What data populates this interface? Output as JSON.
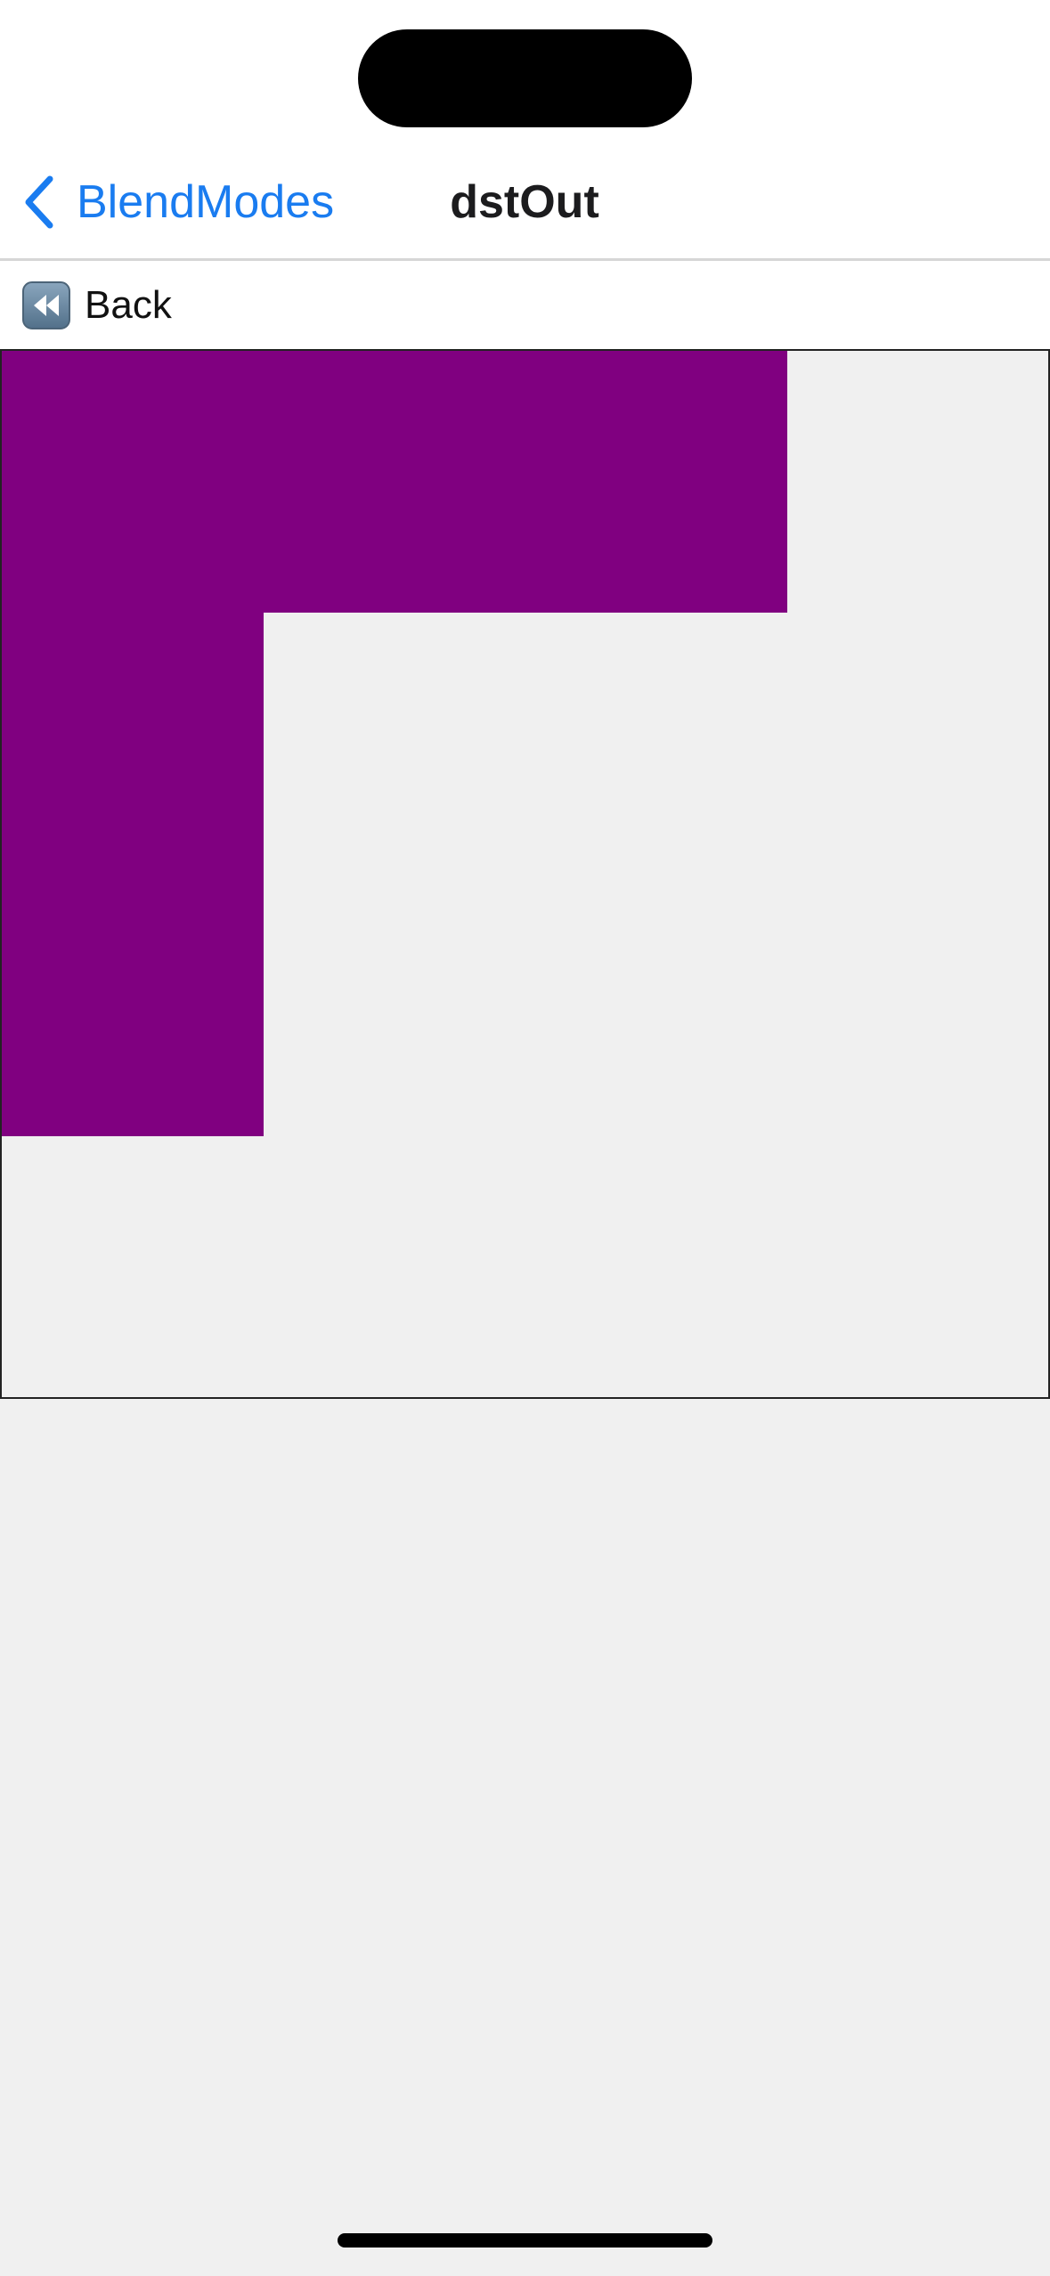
{
  "nav": {
    "back_label": "BlendModes",
    "title": "dstOut"
  },
  "toolbar": {
    "back_button_label": "Back",
    "back_icon": "rewind-icon"
  },
  "canvas": {
    "shape_color": "#800080",
    "background_color": "#f0f0f0",
    "blend_mode": "dstOut"
  },
  "colors": {
    "accent": "#1a7cf0",
    "title": "#1c1c1e"
  }
}
